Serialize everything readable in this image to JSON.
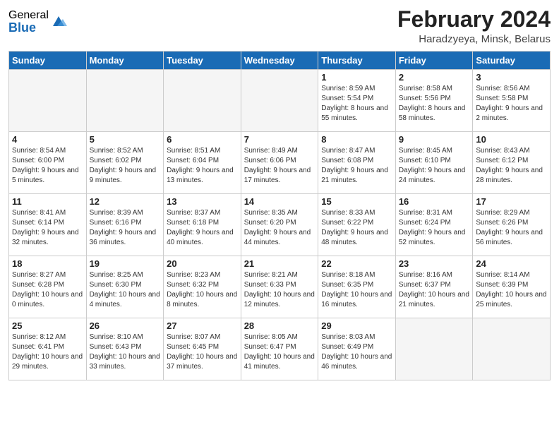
{
  "header": {
    "logo_general": "General",
    "logo_blue": "Blue",
    "month_title": "February 2024",
    "location": "Haradzyeya, Minsk, Belarus"
  },
  "weekdays": [
    "Sunday",
    "Monday",
    "Tuesday",
    "Wednesday",
    "Thursday",
    "Friday",
    "Saturday"
  ],
  "weeks": [
    [
      {
        "day": "",
        "info": ""
      },
      {
        "day": "",
        "info": ""
      },
      {
        "day": "",
        "info": ""
      },
      {
        "day": "",
        "info": ""
      },
      {
        "day": "1",
        "info": "Sunrise: 8:59 AM\nSunset: 5:54 PM\nDaylight: 8 hours\nand 55 minutes."
      },
      {
        "day": "2",
        "info": "Sunrise: 8:58 AM\nSunset: 5:56 PM\nDaylight: 8 hours\nand 58 minutes."
      },
      {
        "day": "3",
        "info": "Sunrise: 8:56 AM\nSunset: 5:58 PM\nDaylight: 9 hours\nand 2 minutes."
      }
    ],
    [
      {
        "day": "4",
        "info": "Sunrise: 8:54 AM\nSunset: 6:00 PM\nDaylight: 9 hours\nand 5 minutes."
      },
      {
        "day": "5",
        "info": "Sunrise: 8:52 AM\nSunset: 6:02 PM\nDaylight: 9 hours\nand 9 minutes."
      },
      {
        "day": "6",
        "info": "Sunrise: 8:51 AM\nSunset: 6:04 PM\nDaylight: 9 hours\nand 13 minutes."
      },
      {
        "day": "7",
        "info": "Sunrise: 8:49 AM\nSunset: 6:06 PM\nDaylight: 9 hours\nand 17 minutes."
      },
      {
        "day": "8",
        "info": "Sunrise: 8:47 AM\nSunset: 6:08 PM\nDaylight: 9 hours\nand 21 minutes."
      },
      {
        "day": "9",
        "info": "Sunrise: 8:45 AM\nSunset: 6:10 PM\nDaylight: 9 hours\nand 24 minutes."
      },
      {
        "day": "10",
        "info": "Sunrise: 8:43 AM\nSunset: 6:12 PM\nDaylight: 9 hours\nand 28 minutes."
      }
    ],
    [
      {
        "day": "11",
        "info": "Sunrise: 8:41 AM\nSunset: 6:14 PM\nDaylight: 9 hours\nand 32 minutes."
      },
      {
        "day": "12",
        "info": "Sunrise: 8:39 AM\nSunset: 6:16 PM\nDaylight: 9 hours\nand 36 minutes."
      },
      {
        "day": "13",
        "info": "Sunrise: 8:37 AM\nSunset: 6:18 PM\nDaylight: 9 hours\nand 40 minutes."
      },
      {
        "day": "14",
        "info": "Sunrise: 8:35 AM\nSunset: 6:20 PM\nDaylight: 9 hours\nand 44 minutes."
      },
      {
        "day": "15",
        "info": "Sunrise: 8:33 AM\nSunset: 6:22 PM\nDaylight: 9 hours\nand 48 minutes."
      },
      {
        "day": "16",
        "info": "Sunrise: 8:31 AM\nSunset: 6:24 PM\nDaylight: 9 hours\nand 52 minutes."
      },
      {
        "day": "17",
        "info": "Sunrise: 8:29 AM\nSunset: 6:26 PM\nDaylight: 9 hours\nand 56 minutes."
      }
    ],
    [
      {
        "day": "18",
        "info": "Sunrise: 8:27 AM\nSunset: 6:28 PM\nDaylight: 10 hours\nand 0 minutes."
      },
      {
        "day": "19",
        "info": "Sunrise: 8:25 AM\nSunset: 6:30 PM\nDaylight: 10 hours\nand 4 minutes."
      },
      {
        "day": "20",
        "info": "Sunrise: 8:23 AM\nSunset: 6:32 PM\nDaylight: 10 hours\nand 8 minutes."
      },
      {
        "day": "21",
        "info": "Sunrise: 8:21 AM\nSunset: 6:33 PM\nDaylight: 10 hours\nand 12 minutes."
      },
      {
        "day": "22",
        "info": "Sunrise: 8:18 AM\nSunset: 6:35 PM\nDaylight: 10 hours\nand 16 minutes."
      },
      {
        "day": "23",
        "info": "Sunrise: 8:16 AM\nSunset: 6:37 PM\nDaylight: 10 hours\nand 21 minutes."
      },
      {
        "day": "24",
        "info": "Sunrise: 8:14 AM\nSunset: 6:39 PM\nDaylight: 10 hours\nand 25 minutes."
      }
    ],
    [
      {
        "day": "25",
        "info": "Sunrise: 8:12 AM\nSunset: 6:41 PM\nDaylight: 10 hours\nand 29 minutes."
      },
      {
        "day": "26",
        "info": "Sunrise: 8:10 AM\nSunset: 6:43 PM\nDaylight: 10 hours\nand 33 minutes."
      },
      {
        "day": "27",
        "info": "Sunrise: 8:07 AM\nSunset: 6:45 PM\nDaylight: 10 hours\nand 37 minutes."
      },
      {
        "day": "28",
        "info": "Sunrise: 8:05 AM\nSunset: 6:47 PM\nDaylight: 10 hours\nand 41 minutes."
      },
      {
        "day": "29",
        "info": "Sunrise: 8:03 AM\nSunset: 6:49 PM\nDaylight: 10 hours\nand 46 minutes."
      },
      {
        "day": "",
        "info": ""
      },
      {
        "day": "",
        "info": ""
      }
    ]
  ]
}
